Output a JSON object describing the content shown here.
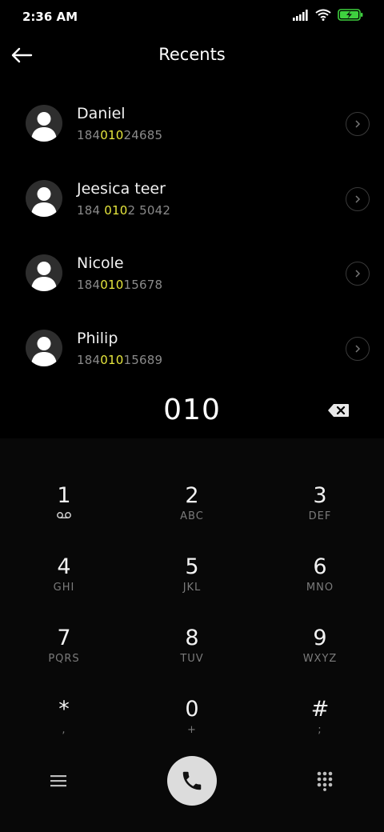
{
  "status_bar": {
    "time": "2:36 AM",
    "icons": [
      "signal-icon",
      "wifi-icon",
      "battery-charging-icon"
    ],
    "battery_color": "#3fd13f"
  },
  "header": {
    "title": "Recents",
    "back_icon": "back-arrow-icon"
  },
  "contacts": [
    {
      "name": "Daniel",
      "number_pre": "184",
      "number_match": "010",
      "number_post": "24685"
    },
    {
      "name": "Jeesica teer",
      "number_pre": "184 ",
      "number_match": "010",
      "number_post": "2 5042"
    },
    {
      "name": "Nicole",
      "number_pre": "184",
      "number_match": "010",
      "number_post": "15678"
    },
    {
      "name": "Philip",
      "number_pre": "184",
      "number_match": "010",
      "number_post": "15689"
    }
  ],
  "highlight_color": "#e6e63d",
  "dial": {
    "number": "010",
    "delete_icon": "backspace-icon"
  },
  "keypad": {
    "keys": [
      {
        "digit": "1",
        "letters": ""
      },
      {
        "digit": "2",
        "letters": "ABC"
      },
      {
        "digit": "3",
        "letters": "DEF"
      },
      {
        "digit": "4",
        "letters": "GHI"
      },
      {
        "digit": "5",
        "letters": "JKL"
      },
      {
        "digit": "6",
        "letters": "MNO"
      },
      {
        "digit": "7",
        "letters": "PQRS"
      },
      {
        "digit": "8",
        "letters": "TUV"
      },
      {
        "digit": "9",
        "letters": "WXYZ"
      },
      {
        "digit": "*",
        "letters": ","
      },
      {
        "digit": "0",
        "letters": "+"
      },
      {
        "digit": "#",
        "letters": ";"
      }
    ]
  },
  "bottom_bar": {
    "menu_icon": "menu-icon",
    "call_icon": "phone-icon",
    "keypad_icon": "dialpad-icon"
  }
}
